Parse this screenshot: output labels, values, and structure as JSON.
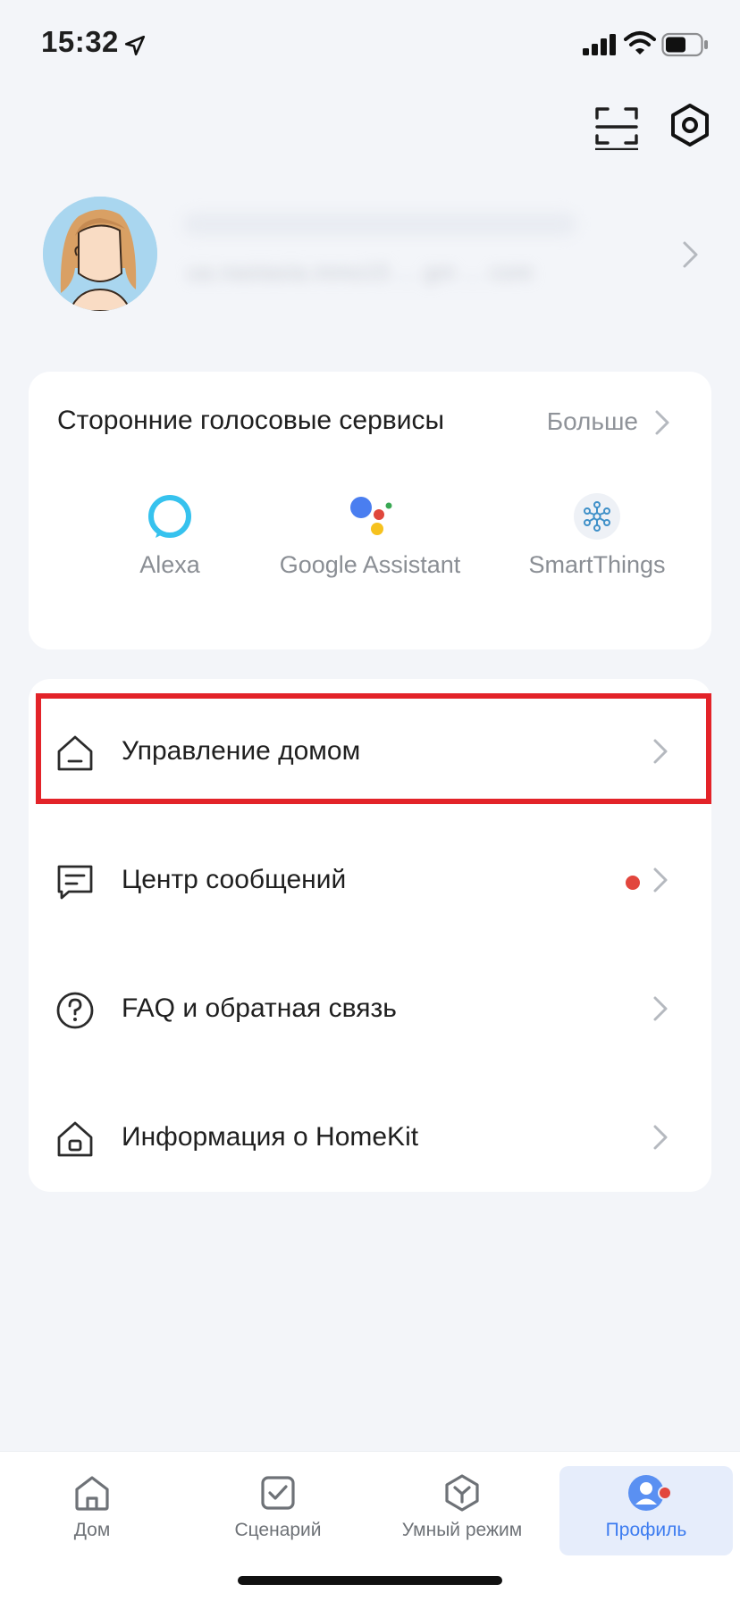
{
  "status_bar": {
    "time": "15:32"
  },
  "profile": {
    "email_blurred": "ua.nastasia.mmo15 ... gm ... com"
  },
  "voice_services": {
    "title": "Сторонние голосовые сервисы",
    "more_label": "Больше",
    "items": [
      {
        "label": "Alexa",
        "icon": "alexa-icon"
      },
      {
        "label": "Google Assistant",
        "icon": "google-assistant-icon"
      },
      {
        "label": "SmartThings",
        "icon": "smartthings-icon"
      }
    ]
  },
  "menu": {
    "items": [
      {
        "label": "Управление домом",
        "icon": "house-icon",
        "highlighted": true
      },
      {
        "label": "Центр сообщений",
        "icon": "message-icon",
        "unread": true
      },
      {
        "label": "FAQ и обратная связь",
        "icon": "question-icon"
      },
      {
        "label": "Информация о HomeKit",
        "icon": "homekit-icon"
      }
    ]
  },
  "tab_bar": {
    "tabs": [
      {
        "label": "Дом",
        "icon": "home-tab-icon"
      },
      {
        "label": "Сценарий",
        "icon": "scenes-tab-icon"
      },
      {
        "label": "Умный режим",
        "icon": "smart-mode-tab-icon"
      },
      {
        "label": "Профиль",
        "icon": "profile-tab-icon",
        "active": true,
        "badge": true
      }
    ]
  },
  "colors": {
    "background": "#f3f5f9",
    "accent": "#3d7cf0",
    "badge": "#e2463d",
    "highlight": "#e32329"
  }
}
